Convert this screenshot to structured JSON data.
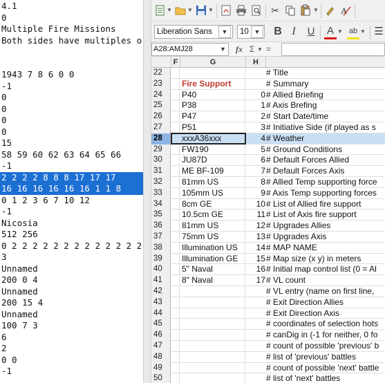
{
  "text_editor": {
    "lines": [
      "4.1",
      "0",
      "Multiple Fire Missions",
      "Both sides have multiples o",
      "",
      "",
      "1943 7 8 6 0 0",
      "-1",
      "0",
      "0",
      "0",
      "0",
      "15",
      "58 59 60 62 63 64 65 66",
      "-1",
      "2 2 2 2 8 8 8 17 17 17",
      "16 16 16 16 16 16 1 1 8",
      "0 1 2 3 6 7 10 12",
      "-1",
      "Nicosia",
      "512 256",
      "0 2 2 2 2 2 2 2 2 2 2 2 2 2",
      "3",
      "Unnamed",
      "200 0 4",
      "Unnamed",
      "200 15 4",
      "Unnamed",
      "100 7 3",
      "6",
      "2",
      "0 0",
      "-1"
    ],
    "selected_lines": [
      15,
      16
    ],
    "selection_color": "#1c6fd3"
  },
  "spreadsheet": {
    "toolbar": {
      "font_name": "Liberation Sans",
      "font_size": "10",
      "bold": "B",
      "italic": "I",
      "underline": "U",
      "font_color_glyph": "A",
      "highlight_glyph": "ab",
      "icons": [
        "new-document-icon",
        "open-folder-icon",
        "save-icon",
        "export-pdf-icon",
        "print-icon",
        "print-preview-icon",
        "cut-icon",
        "copy-icon",
        "paste-icon",
        "clone-formatting-icon",
        "clear-formatting-icon"
      ]
    },
    "name_box": "A28:AMJ28",
    "formula_symbols": {
      "fx": "fx",
      "sigma": "Σ",
      "equals": "="
    },
    "column_headers": [
      "F",
      "G",
      "H"
    ],
    "active_row": 28,
    "rows": [
      {
        "num": "22",
        "g": "",
        "h": "",
        "i": "# Title"
      },
      {
        "num": "23",
        "g": "Fire Support",
        "h": "",
        "i": "# Summary",
        "g_red": true
      },
      {
        "num": "24",
        "g": "P40",
        "h": "0",
        "i": "# Allied Briefing"
      },
      {
        "num": "25",
        "g": "P38",
        "h": "1",
        "i": "# Axis Brefing"
      },
      {
        "num": "26",
        "g": "P47",
        "h": "2",
        "i": "# Start Date/time"
      },
      {
        "num": "27",
        "g": "P51",
        "h": "3",
        "i": "# Initiative Side (if played as s"
      },
      {
        "num": "28",
        "g": "xxxA36xxx",
        "h": "4",
        "i": "# Weather"
      },
      {
        "num": "29",
        "g": "FW190",
        "h": "5",
        "i": "# Ground Conditions"
      },
      {
        "num": "30",
        "g": "JU87D",
        "h": "6",
        "i": "# Default Forces Allied"
      },
      {
        "num": "31",
        "g": "ME BF-109",
        "h": "7",
        "i": "# Default Forces Axis"
      },
      {
        "num": "32",
        "g": "81mm US",
        "h": "8",
        "i": "# Allied Temp supporting force"
      },
      {
        "num": "33",
        "g": "105mm US",
        "h": "9",
        "i": "# Axis Temp supporting forces"
      },
      {
        "num": "34",
        "g": "8cm GE",
        "h": "10",
        "i": "# List of Allied fire support"
      },
      {
        "num": "35",
        "g": "10.5cm GE",
        "h": "11",
        "i": "# List of Axis fire support"
      },
      {
        "num": "36",
        "g": "81mm US",
        "h": "12",
        "i": "# Upgrades Allies"
      },
      {
        "num": "37",
        "g": "75mm US",
        "h": "13",
        "i": "# Upgrades Axis"
      },
      {
        "num": "38",
        "g": "Illumination US",
        "h": "14",
        "i": "# MAP NAME"
      },
      {
        "num": "39",
        "g": "Illumination GE",
        "h": "15",
        "i": "# Map size (x y) in meters"
      },
      {
        "num": "40",
        "g": "5\" Naval",
        "h": "16",
        "i": "# Initial map control list (0 = Al"
      },
      {
        "num": "41",
        "g": "8\" Naval",
        "h": "17",
        "i": "# VL count"
      },
      {
        "num": "42",
        "g": "",
        "h": "",
        "i": "# VL entry (name on first line,"
      },
      {
        "num": "43",
        "g": "",
        "h": "",
        "i": "# Exit Direction Allies"
      },
      {
        "num": "44",
        "g": "",
        "h": "",
        "i": "# Exit Direction Axis"
      },
      {
        "num": "45",
        "g": "",
        "h": "",
        "i": "# coordinates of selection hots"
      },
      {
        "num": "46",
        "g": "",
        "h": "",
        "i": "# canDig in (-1 for neither, 0 fo"
      },
      {
        "num": "47",
        "g": "",
        "h": "",
        "i": "# count of possible 'previous' b"
      },
      {
        "num": "48",
        "g": "",
        "h": "",
        "i": "# list of 'previous' battles"
      },
      {
        "num": "49",
        "g": "",
        "h": "",
        "i": "# count of possible 'next' battle"
      },
      {
        "num": "50",
        "g": "",
        "h": "",
        "i": "# list of 'next' battles"
      }
    ],
    "colors": {
      "active_row_bg": "#c9dff4",
      "active_rownum_bg": "#8db4e2",
      "red_text": "#c0392b"
    }
  }
}
